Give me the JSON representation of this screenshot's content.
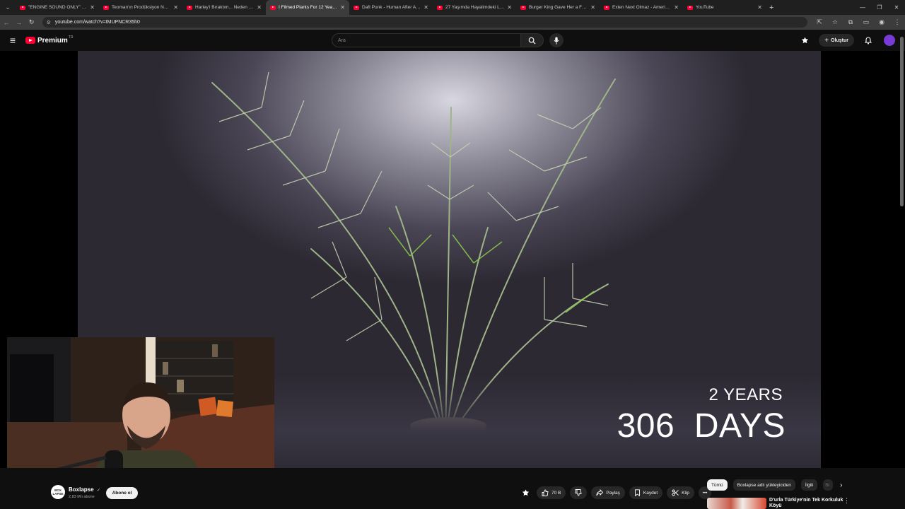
{
  "browser": {
    "tabs": [
      {
        "title": "\"ENGINE SOUND ONLY\" | CUR",
        "active": false
      },
      {
        "title": "Teoman'ın Prodüksiyon Notları",
        "active": false
      },
      {
        "title": "Harley'i Bıraktım... Neden F800",
        "active": false
      },
      {
        "title": "I Filmed Plants For 12 Years - Y",
        "active": true
      },
      {
        "title": "Daft Punk - Human After All (O",
        "active": false
      },
      {
        "title": "27 Yaşımda Hayalimdeki Lamb",
        "active": false
      },
      {
        "title": "Burger King Gave Her a Fake B",
        "active": false
      },
      {
        "title": "Exten Next Olmaz - Amerika'da",
        "active": false
      },
      {
        "title": "YouTube",
        "active": false
      }
    ],
    "url": "youtube.com/watch?v=tMUPNCR35h0"
  },
  "header": {
    "logo_text": "Premium",
    "country_code": "TR",
    "search_placeholder": "Ara",
    "create_label": "Oluştur"
  },
  "video": {
    "overlay_years": "2 YEARS",
    "overlay_days": "306  DAYS"
  },
  "channel": {
    "avatar_text": "BOX LAPSE",
    "name": "Boxlapse",
    "subscribers": "2,83 Mn abone",
    "subscribe_label": "Abone ol"
  },
  "actions": {
    "like_count": "70 B",
    "share_label": "Paylaş",
    "save_label": "Kaydet",
    "clip_label": "Klip"
  },
  "chips": [
    "Tümü",
    "Boxlapse adlı yükleyiciden",
    "İlgili",
    "Si"
  ],
  "recommendation": {
    "title": "D'urla Türkiye'nin Tek  Korkuluk",
    "subtitle": "Köyü"
  },
  "colors": {
    "brand_red": "#ff0033",
    "background": "#0f0f0f"
  }
}
